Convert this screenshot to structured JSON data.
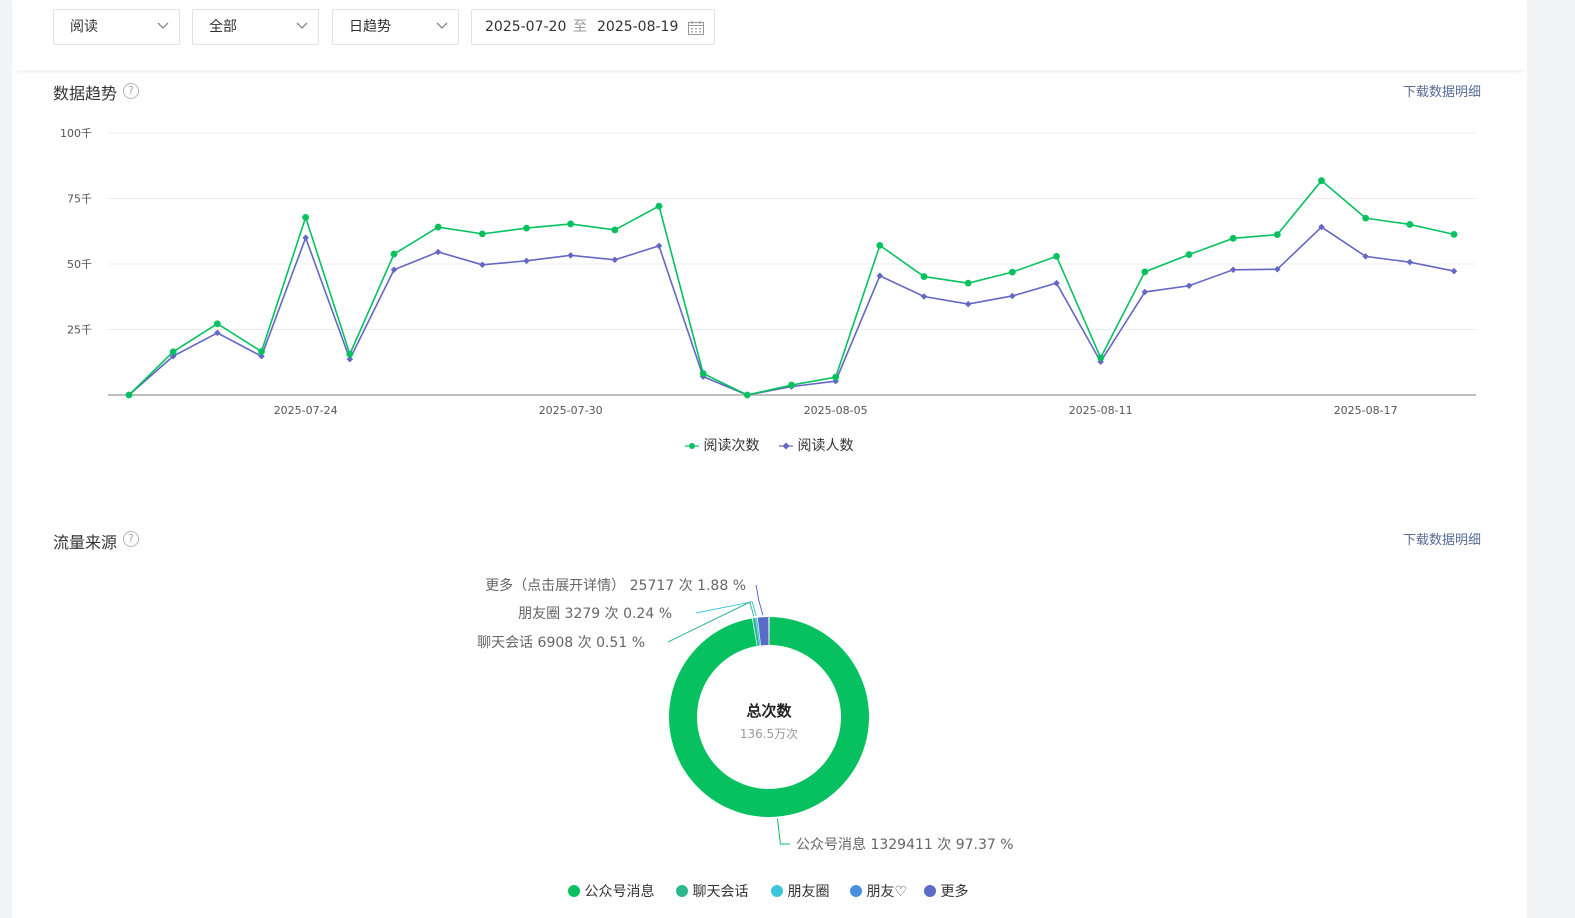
{
  "filters": {
    "metric": "阅读",
    "scope": "全部",
    "granularity": "日趋势",
    "date_start": "2025-07-20",
    "date_sep": "至",
    "date_end": "2025-08-19"
  },
  "trend": {
    "title": "数据趋势",
    "help": "?",
    "download": "下载数据明细"
  },
  "source": {
    "title": "流量来源",
    "help": "?",
    "download": "下载数据明细"
  },
  "chart_data": [
    {
      "type": "line",
      "x": [
        "2025-07-20",
        "2025-07-21",
        "2025-07-22",
        "2025-07-23",
        "2025-07-24",
        "2025-07-25",
        "2025-07-26",
        "2025-07-27",
        "2025-07-28",
        "2025-07-29",
        "2025-07-30",
        "2025-07-31",
        "2025-08-01",
        "2025-08-02",
        "2025-08-03",
        "2025-08-04",
        "2025-08-05",
        "2025-08-06",
        "2025-08-07",
        "2025-08-08",
        "2025-08-09",
        "2025-08-10",
        "2025-08-11",
        "2025-08-12",
        "2025-08-13",
        "2025-08-14",
        "2025-08-15",
        "2025-08-16",
        "2025-08-17",
        "2025-08-18",
        "2025-08-19"
      ],
      "x_ticks": [
        "2025-07-24",
        "2025-07-30",
        "2025-08-05",
        "2025-08-11",
        "2025-08-17"
      ],
      "y_ticks": [
        "100千",
        "75千",
        "50千",
        "25千"
      ],
      "ylim": [
        0,
        100000
      ],
      "grid": true,
      "legend_position": "bottom-center",
      "series": [
        {
          "name": "阅读次数",
          "color": "#07c160",
          "values": [
            0,
            16500,
            27200,
            16600,
            67800,
            15600,
            53800,
            64100,
            61500,
            63700,
            65300,
            63000,
            72100,
            8200,
            0,
            3800,
            6800,
            57100,
            45200,
            42700,
            46900,
            52900,
            14200,
            47000,
            53600,
            59800,
            61200,
            81800,
            67500,
            65100,
            61300
          ]
        },
        {
          "name": "阅读人数",
          "color": "#6467c4",
          "values": [
            0,
            14800,
            23700,
            14800,
            60000,
            13700,
            47800,
            54600,
            49700,
            51200,
            53300,
            51600,
            56900,
            7000,
            0,
            3200,
            5300,
            45500,
            37600,
            34700,
            37800,
            42700,
            12700,
            39300,
            41700,
            47800,
            48000,
            64100,
            52900,
            50700,
            47300
          ]
        }
      ]
    },
    {
      "type": "pie",
      "center_title": "总次数",
      "center_value": "136.5万次",
      "labels_on_chart": [
        {
          "text": "更多（点击展开详情） 25717 次 1.88 %"
        },
        {
          "text": "朋友圈 3279 次 0.24 %"
        },
        {
          "text": "聊天会话 6908 次 0.51 %"
        },
        {
          "text": "公众号消息 1329411 次 97.37 %"
        }
      ],
      "slices": [
        {
          "name": "公众号消息",
          "value": 1329411,
          "percent": 97.37,
          "color": "#07c160"
        },
        {
          "name": "聊天会话",
          "value": 6908,
          "percent": 0.51,
          "color": "#2db88e"
        },
        {
          "name": "朋友圈",
          "value": 3279,
          "percent": 0.24,
          "color": "#3ec5dd"
        },
        {
          "name": "朋友♡",
          "value": 0,
          "percent": 0,
          "color": "#4a90e2"
        },
        {
          "name": "更多",
          "value": 25717,
          "percent": 1.88,
          "color": "#5b6bc8"
        }
      ],
      "legend_position": "bottom-center"
    }
  ]
}
